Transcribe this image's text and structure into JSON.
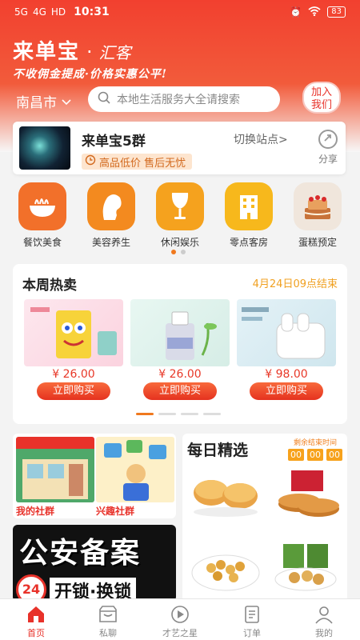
{
  "status_bar": {
    "signal": "5G",
    "signal2": "4G",
    "hd": "HD",
    "time": "10:31",
    "battery": "83"
  },
  "brand": {
    "name": "来单宝",
    "separator": "·",
    "sub": "汇客",
    "slogan": "不收佣金提成·价格实惠公平!"
  },
  "location": {
    "city": "南昌市"
  },
  "search": {
    "placeholder": "本地生活服务大全请搜索"
  },
  "join": {
    "line1": "加入",
    "line2": "我们"
  },
  "group": {
    "name": "来单宝5群",
    "tag": "高品低价 售后无忧",
    "switch_label": "切换站点>",
    "share_label": "分享"
  },
  "categories": [
    {
      "label": "餐饮美食",
      "icon": "noodle-bowl-icon",
      "color": "#f2702a"
    },
    {
      "label": "美容养生",
      "icon": "woman-profile-icon",
      "color": "#f38a1f"
    },
    {
      "label": "休闲娱乐",
      "icon": "wine-glass-icon",
      "color": "#f5a21e"
    },
    {
      "label": "零点客房",
      "icon": "building-icon",
      "color": "#f7b81c"
    },
    {
      "label": "蛋糕预定",
      "icon": "cake-icon",
      "color": "#f0e6dc"
    }
  ],
  "hot": {
    "title": "本周热卖",
    "end_time": "4月24日09点结束",
    "products": [
      {
        "price": "¥ 26.00",
        "buy": "立即购买"
      },
      {
        "price": "¥ 26.00",
        "buy": "立即购买"
      },
      {
        "price": "¥ 98.00",
        "buy": "立即购买"
      }
    ]
  },
  "community": {
    "my_group": "我的社群",
    "interest_group": "兴趣社群",
    "banner_text": "公安备案",
    "banner_sub": "开锁·换锁",
    "badge": "24"
  },
  "daily": {
    "title": "每日精选",
    "countdown_label": "剩余结束时间",
    "countdown": [
      "00",
      "00",
      "00"
    ]
  },
  "tabs": [
    {
      "label": "首页",
      "icon": "home-icon",
      "active": true
    },
    {
      "label": "私聊",
      "icon": "chat-icon",
      "active": false
    },
    {
      "label": "才艺之星",
      "icon": "play-icon",
      "active": false
    },
    {
      "label": "订单",
      "icon": "order-icon",
      "active": false
    },
    {
      "label": "我的",
      "icon": "user-icon",
      "active": false
    }
  ],
  "colors": {
    "primary": "#e8322a",
    "accent": "#f0791e"
  }
}
